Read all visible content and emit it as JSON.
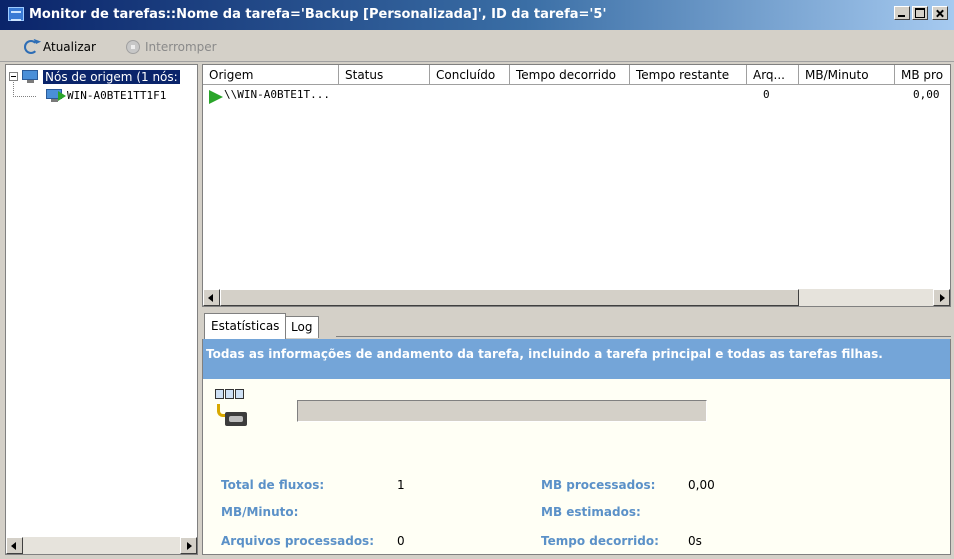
{
  "window": {
    "title": "Monitor de tarefas::Nome da tarefa='Backup [Personalizada]', ID da tarefa='5'"
  },
  "toolbar": {
    "refresh_label": "Atualizar",
    "stop_label": "Interromper"
  },
  "tree": {
    "root_label": "Nós de origem (1 nós:",
    "child_label": "WIN-A0BTE1TT1F1"
  },
  "grid": {
    "columns": [
      "Origem",
      "Status",
      "Concluído",
      "Tempo decorrido",
      "Tempo restante",
      "Arq...",
      "MB/Minuto",
      "MB pro"
    ],
    "rows": [
      {
        "origem": "\\\\WIN-A0BTE1T...",
        "status": "",
        "concluido": "",
        "tempo_decorrido": "",
        "tempo_restante": "",
        "arq": "0",
        "mb_minuto": "",
        "mb_pro": "0,00"
      }
    ]
  },
  "tabs": [
    "Estatísticas",
    "Log"
  ],
  "stats": {
    "info": "Todas as informações de andamento da tarefa, incluindo a tarefa principal e todas as tarefas filhas.",
    "total_fluxos_label": "Total de fluxos:",
    "total_fluxos_value": "1",
    "mb_minuto_label": "MB/Minuto:",
    "mb_minuto_value": "",
    "arquivos_label": "Arquivos processados:",
    "arquivos_value": "0",
    "mb_processados_label": "MB processados:",
    "mb_processados_value": "0,00",
    "mb_estimados_label": "MB estimados:",
    "mb_estimados_value": "",
    "tempo_decorrido_label": "Tempo decorrido:",
    "tempo_decorrido_value": "0s"
  },
  "colors": {
    "titlebar": "#0a246a",
    "info_bar": "#74a5d8",
    "stat_label": "#5b91c8",
    "running": "#2aa52a"
  }
}
